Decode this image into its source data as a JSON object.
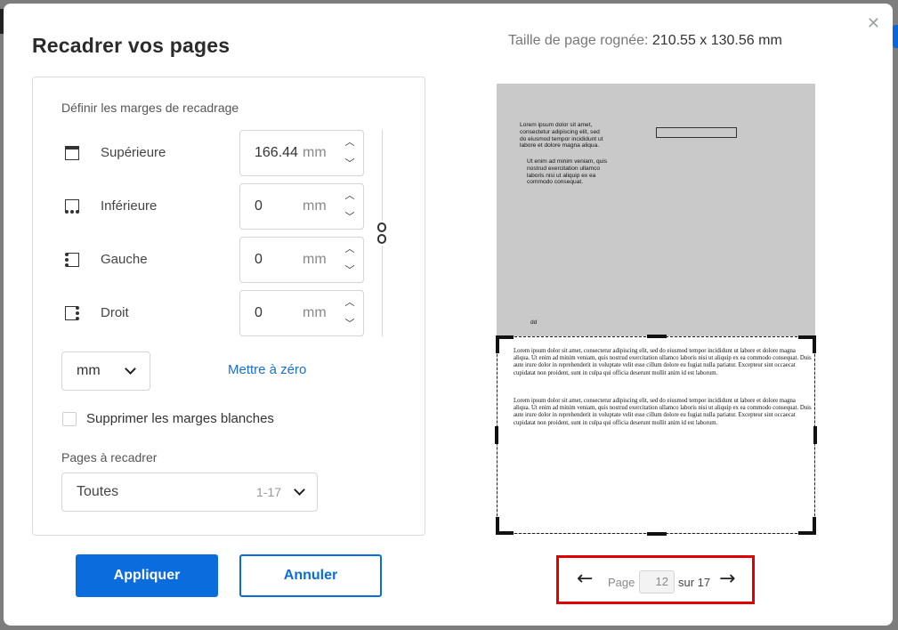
{
  "modal": {
    "title": "Recadrer vos pages",
    "close_icon": "close-icon",
    "cropped_size_label": "Taille de page rognée:",
    "cropped_size_value": "210.55 x 130.56 mm"
  },
  "margins": {
    "section_label": "Définir les marges de recadrage",
    "rows": [
      {
        "label": "Supérieure",
        "value": "166.44",
        "unit": "mm",
        "icon": "margin-top-icon"
      },
      {
        "label": "Inférieure",
        "value": "0",
        "unit": "mm",
        "icon": "margin-bottom-icon"
      },
      {
        "label": "Gauche",
        "value": "0",
        "unit": "mm",
        "icon": "margin-left-icon"
      },
      {
        "label": "Droit",
        "value": "0",
        "unit": "mm",
        "icon": "margin-right-icon"
      }
    ],
    "link_icon": "chain-link-icon",
    "unit_select": "mm",
    "reset_link": "Mettre à zéro"
  },
  "options": {
    "remove_white_margins": "Supprimer les marges blanches",
    "remove_white_margins_checked": false
  },
  "pages": {
    "label": "Pages à recadrer",
    "selected": "Toutes",
    "range": "1-17"
  },
  "buttons": {
    "apply": "Appliquer",
    "cancel": "Annuler"
  },
  "preview": {
    "text_block_1": "Lorem ipsum dolor sit amet,\nconsectetur adipiscing elit, sed\ndo eiusmod tempor incididunt ut\nlabore et dolore magna aliqua.",
    "text_block_2": "Ut enim ad minim veniam, quis\nnostrud exercitation ullamco\nlaboris nisi ut aliquip ex ea\ncommodo consequat.",
    "text_small": "dd",
    "paragraph_1": "Lorem ipsum dolor sit amet, consectetur adipiscing elit, sed do eiusmod tempor incididunt ut labore et dolore magna aliqua. Ut enim ad minim veniam, quis nostrud exercitation ullamco laboris nisi ut aliquip ex ea commodo consequat. Duis aute irure dolor in reprehenderit in voluptate velit esse cillum dolore eu fugiat nulla pariatur. Excepteur sint occaecat cupidatat non proident, sunt in culpa qui officia deserunt mollit anim id est laborum.",
    "paragraph_2": "Lorem ipsum dolor sit amet, consectetur adipiscing elit, sed do eiusmod tempor incididunt ut labore et dolore magna aliqua. Ut enim ad minim veniam, quis nostrud exercitation ullamco laboris nisi ut aliquip ex ea commodo consequat. Duis aute irure dolor in reprehenderit in voluptate velit esse cillum dolore eu fugiat nulla pariatur. Excepteur sint occaecat cupidatat non proident, sunt in culpa qui officia deserunt mollit anim id est laborum."
  },
  "pager": {
    "prev_icon": "arrow-left-icon",
    "next_icon": "arrow-right-icon",
    "page_label": "Page",
    "current_page": "12",
    "of_label": "sur 17",
    "highlight_color": "#e00000"
  },
  "colors": {
    "primary": "#0b6cde",
    "link": "#1a6fd6",
    "cropped_area": "#c9c9c9"
  }
}
